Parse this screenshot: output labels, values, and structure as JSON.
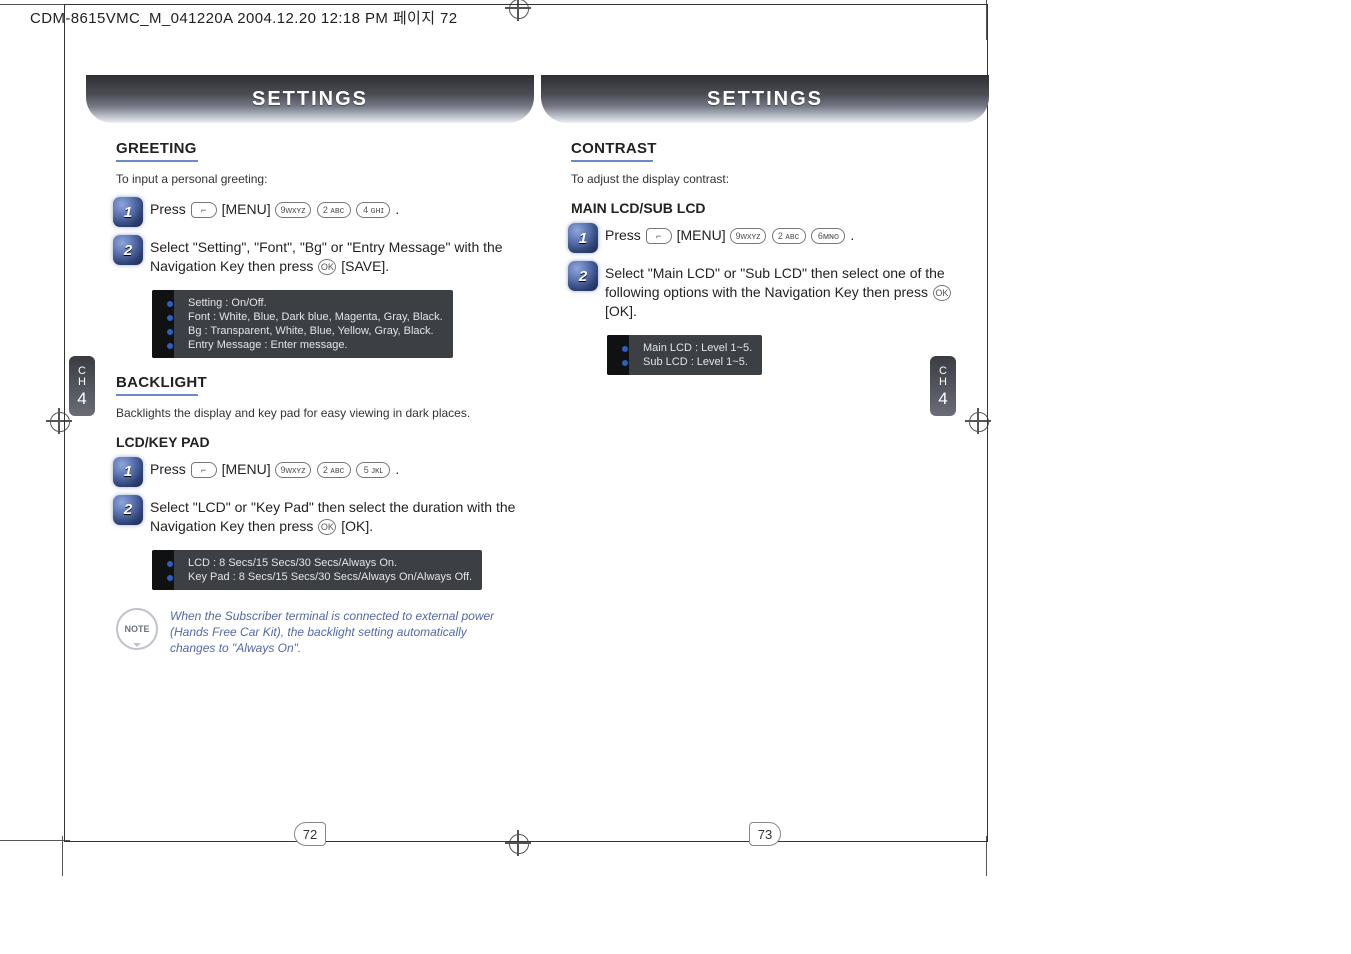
{
  "slug": "CDM-8615VMC_M_041220A  2004.12.20  12:18 PM  페이지 72",
  "chapter": {
    "label": "C\nH",
    "number": "4"
  },
  "pages": {
    "left": {
      "banner": "SETTINGS",
      "page_number": "72",
      "sections": [
        {
          "title": "GREETING",
          "intro": "To input a personal greeting:",
          "steps": [
            {
              "num": "1",
              "text_pre": "Press ",
              "menu_label": " [MENU] ",
              "keys": [
                "9ᴡxʏz",
                "2 ᴀʙᴄ",
                "4 ɢʜɪ"
              ],
              "text_post": " ."
            },
            {
              "num": "2",
              "text_pre": "Select \"Setting\", \"Font\", \"Bg\" or \"Entry Message\" with the Navigation Key then press ",
              "ok": "OK",
              "text_post": " [SAVE]."
            }
          ],
          "infobox": [
            "Setting : On/Off.",
            "Font : White, Blue, Dark blue, Magenta, Gray, Black.",
            "Bg : Transparent, White, Blue, Yellow, Gray, Black.",
            "Entry Message : Enter message."
          ]
        },
        {
          "title": "BACKLIGHT",
          "intro": "Backlights the display and key pad for easy viewing in dark places.",
          "subhead": "LCD/KEY PAD",
          "steps": [
            {
              "num": "1",
              "text_pre": "Press ",
              "menu_label": " [MENU] ",
              "keys": [
                "9ᴡxʏz",
                "2 ᴀʙᴄ",
                "5 ᴊᴋʟ"
              ],
              "text_post": " ."
            },
            {
              "num": "2",
              "text_pre": "Select \"LCD\" or \"Key Pad\" then select the duration with the Navigation Key then press ",
              "ok": "OK",
              "text_post": " [OK]."
            }
          ],
          "infobox": [
            "LCD : 8 Secs/15 Secs/30 Secs/Always On.",
            "Key Pad : 8 Secs/15 Secs/30 Secs/Always On/Always Off."
          ],
          "note": "When the Subscriber terminal is connected to external power (Hands Free Car Kit), the backlight setting automatically changes to \"Always On\"."
        }
      ]
    },
    "right": {
      "banner": "SETTINGS",
      "page_number": "73",
      "sections": [
        {
          "title": "CONTRAST",
          "intro": "To adjust the display contrast:",
          "subhead": "MAIN LCD/SUB LCD",
          "steps": [
            {
              "num": "1",
              "text_pre": "Press ",
              "menu_label": " [MENU] ",
              "keys": [
                "9ᴡxʏz",
                "2 ᴀʙᴄ",
                "6ᴍɴᴏ"
              ],
              "text_post": " ."
            },
            {
              "num": "2",
              "text_pre": "Select \"Main LCD\" or \"Sub LCD\" then select one of the following options with the Navigation Key then press ",
              "ok": "OK",
              "text_post": " [OK]."
            }
          ],
          "infobox": [
            "Main LCD : Level 1~5.",
            "Sub LCD : Level 1~5."
          ]
        }
      ]
    }
  },
  "note_badge": "NOTE"
}
